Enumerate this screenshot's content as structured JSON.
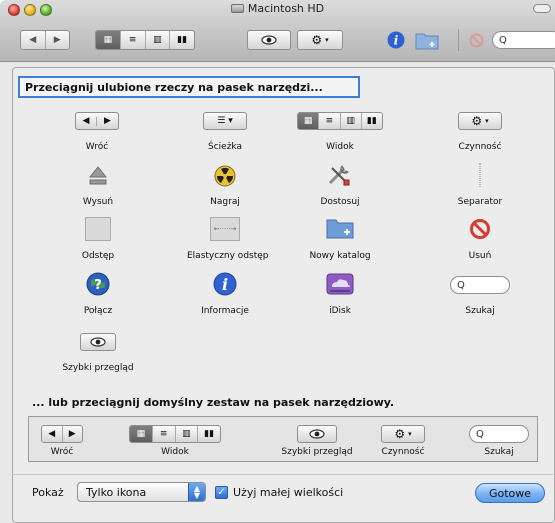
{
  "window": {
    "title": "Macintosh HD"
  },
  "toolbar": {
    "search_placeholder": "Q"
  },
  "sheet": {
    "instruction_top": "Przeciągnij ulubione rzeczy na pasek narzędzi...",
    "instruction_bottom": "... lub przeciągnij domyślny zestaw na pasek narzędziowy.",
    "items": {
      "back": "Wróć",
      "path": "Ścieżka",
      "view": "Widok",
      "action": "Czynność",
      "eject": "Wysuń",
      "burn": "Nagraj",
      "customize": "Dostosuj",
      "separator": "Separator",
      "space": "Odstęp",
      "flexible_space": "Elastyczny odstęp",
      "new_folder": "Nowy katalog",
      "delete": "Usuń",
      "connect": "Połącz",
      "info": "Informacje",
      "idisk": "iDisk",
      "search": "Szukaj",
      "quick_look": "Szybki przegląd"
    },
    "default_set": {
      "back": "Wróć",
      "view": "Widok",
      "quick_look": "Szybki przegląd",
      "action": "Czynność",
      "search": "Szukaj"
    }
  },
  "footer": {
    "show_label": "Pokaż",
    "show_value": "Tylko ikona",
    "small_size_label": "Użyj małej wielkości",
    "small_size_checked": true,
    "done": "Gotowe"
  },
  "colors": {
    "selection_ring": "#3b7fd6",
    "aqua_blue": "#5b9be8"
  }
}
